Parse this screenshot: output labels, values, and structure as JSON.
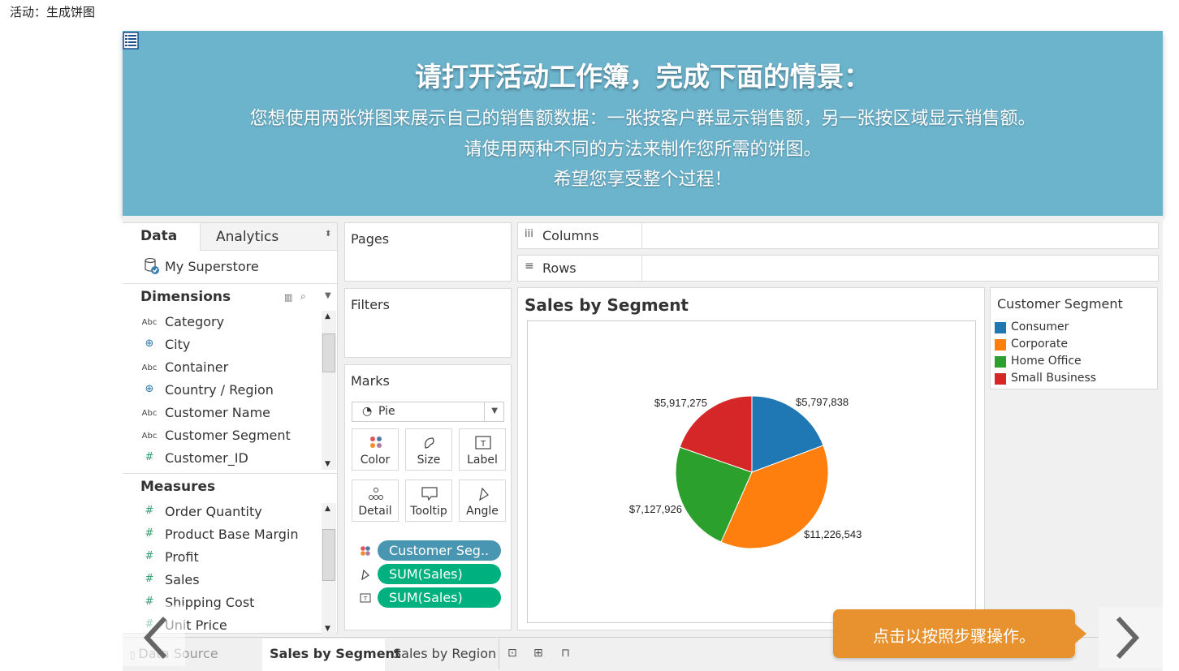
{
  "page": {
    "title": "活动：生成饼图"
  },
  "banner": {
    "heading": "请打开活动工作簿，完成下面的情景：",
    "line1": "您想使用两张饼图来展示自己的销售额数据：一张按客户群显示销售额，另一张按区域显示销售额。",
    "line2": "请使用两种不同的方法来制作您所需的饼图。",
    "line3": "希望您享受整个过程！"
  },
  "data_pane": {
    "tab_data": "Data",
    "tab_analytics": "Analytics",
    "datasource": "My Superstore",
    "dimensions_header": "Dimensions",
    "dimensions": [
      {
        "type": "Abc",
        "name": "Category"
      },
      {
        "type": "globe",
        "name": "City"
      },
      {
        "type": "Abc",
        "name": "Container"
      },
      {
        "type": "globe",
        "name": "Country / Region"
      },
      {
        "type": "Abc",
        "name": "Customer Name"
      },
      {
        "type": "Abc",
        "name": "Customer Segment"
      },
      {
        "type": "#",
        "name": "Customer_ID"
      }
    ],
    "measures_header": "Measures",
    "measures": [
      {
        "type": "#",
        "name": "Order Quantity"
      },
      {
        "type": "#",
        "name": "Product Base Margin"
      },
      {
        "type": "#",
        "name": "Profit"
      },
      {
        "type": "#",
        "name": "Sales"
      },
      {
        "type": "#",
        "name": "Shipping Cost"
      },
      {
        "type": "#",
        "name": "Unit Price"
      }
    ]
  },
  "shelves": {
    "pages": "Pages",
    "filters": "Filters",
    "columns": "Columns",
    "rows": "Rows"
  },
  "marks": {
    "header": "Marks",
    "type": "Pie",
    "buttons": [
      "Color",
      "Size",
      "Label",
      "Detail",
      "Tooltip",
      "Angle"
    ],
    "pills": [
      {
        "icon": "color-icon",
        "label": "Customer Seg..",
        "color": "#4996b2"
      },
      {
        "icon": "angle-icon",
        "label": "SUM(Sales)",
        "color": "#00b180"
      },
      {
        "icon": "label-icon",
        "label": "SUM(Sales)",
        "color": "#00b180"
      }
    ]
  },
  "view": {
    "title": "Sales by Segment"
  },
  "chart_data": {
    "type": "pie",
    "title": "Sales by Segment",
    "slices": [
      {
        "label": "Consumer",
        "value": 5797838,
        "display": "$5,797,838",
        "color": "#1f77b4"
      },
      {
        "label": "Corporate",
        "value": 11226543,
        "display": "$11,226,543",
        "color": "#ff7f0e"
      },
      {
        "label": "Home Office",
        "value": 7127926,
        "display": "$7,127,926",
        "color": "#2ca02c"
      },
      {
        "label": "Small Business",
        "value": 5917275,
        "display": "$5,917,275",
        "color": "#d62728"
      }
    ]
  },
  "legend": {
    "title": "Customer Segment",
    "items": [
      {
        "label": "Consumer",
        "color": "#1f77b4"
      },
      {
        "label": "Corporate",
        "color": "#ff7f0e"
      },
      {
        "label": "Home Office",
        "color": "#2ca02c"
      },
      {
        "label": "Small Business",
        "color": "#d62728"
      }
    ]
  },
  "tabs": {
    "datasource": "Data Source",
    "sheets": [
      "Sales by Segment",
      "Sales by Region"
    ],
    "active": "Sales by Segment"
  },
  "callout": {
    "text": "点击以按照步骤操作。",
    "color": "#e8922f"
  }
}
